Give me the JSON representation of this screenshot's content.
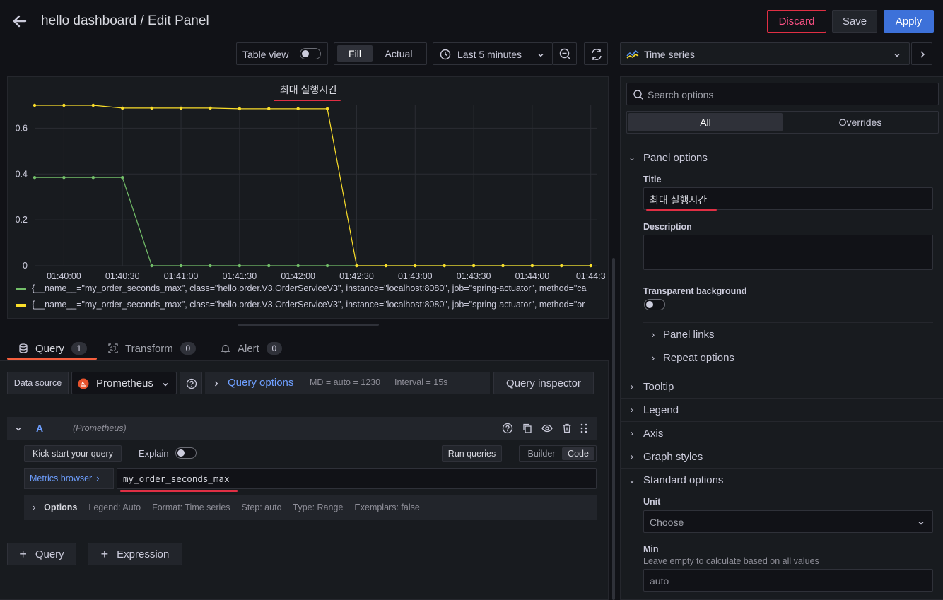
{
  "header": {
    "breadcrumb": "hello dashboard / Edit Panel",
    "discard_label": "Discard",
    "save_label": "Save",
    "apply_label": "Apply"
  },
  "toolbar": {
    "table_view_label": "Table view",
    "fill_label": "Fill",
    "actual_label": "Actual",
    "time_range_label": "Last 5 minutes",
    "visualization_label": "Time series"
  },
  "panel": {
    "title": "최대 실행시간"
  },
  "chart_data": {
    "type": "line",
    "title": "최대 실행시간",
    "x": [
      "01:39:35",
      "01:40:00",
      "01:40:15",
      "01:40:30",
      "01:40:45",
      "01:41:00",
      "01:41:15",
      "01:41:30",
      "01:41:45",
      "01:42:00",
      "01:42:15",
      "01:42:30",
      "01:42:45",
      "01:43:00",
      "01:43:15",
      "01:43:30",
      "01:43:45",
      "01:44:00",
      "01:44:15",
      "01:44:30"
    ],
    "x_tick_labels": [
      "01:40:00",
      "01:40:30",
      "01:41:00",
      "01:41:30",
      "01:42:00",
      "01:42:30",
      "01:43:00",
      "01:43:30",
      "01:44:00",
      "01:44:3"
    ],
    "y_tick_labels": [
      "0",
      "0.2",
      "0.4",
      "0.6"
    ],
    "ylim": [
      0,
      0.7
    ],
    "grid": true,
    "legend_position": "bottom",
    "series": [
      {
        "name": "{__name__=\"my_order_seconds_max\", class=\"hello.order.V3.OrderServiceV3\", instance=\"localhost:8080\", job=\"spring-actuator\", method=\"ca",
        "color": "#73bf69",
        "values": [
          0.385,
          0.385,
          0.385,
          0.385,
          0,
          0,
          0,
          0,
          0,
          0,
          0,
          0,
          0,
          0,
          0,
          0,
          0,
          0,
          0,
          0
        ]
      },
      {
        "name": "{__name__=\"my_order_seconds_max\", class=\"hello.order.V3.OrderServiceV3\", instance=\"localhost:8080\", job=\"spring-actuator\", method=\"or",
        "color": "#fade2a",
        "values": [
          0.7,
          0.7,
          0.7,
          0.688,
          0.688,
          0.688,
          0.688,
          0.685,
          0.685,
          0.685,
          0.685,
          0,
          0,
          0,
          0,
          0,
          0,
          0,
          0,
          0
        ]
      }
    ]
  },
  "tabs": [
    {
      "label": "Query",
      "count": "1"
    },
    {
      "label": "Transform",
      "count": "0"
    },
    {
      "label": "Alert",
      "count": "0"
    }
  ],
  "query_bar": {
    "data_source_label": "Data source",
    "data_source_value": "Prometheus",
    "query_options_label": "Query options",
    "md_text": "MD = auto = 1230",
    "interval_text": "Interval = 15s",
    "query_inspector_label": "Query inspector"
  },
  "query_row": {
    "ref_id": "A",
    "datasource_hint": "(Prometheus)",
    "kick_start_label": "Kick start your query",
    "explain_label": "Explain",
    "run_queries_label": "Run queries",
    "builder_label": "Builder",
    "code_label": "Code",
    "metrics_browser_label": "Metrics browser",
    "expression": "my_order_seconds_max",
    "options_label": "Options",
    "legend_info": "Legend: Auto",
    "format_info": "Format: Time series",
    "step_info": "Step: auto",
    "type_info": "Type: Range",
    "exemplars_info": "Exemplars: false"
  },
  "add_buttons": {
    "query_label": "Query",
    "expression_label": "Expression"
  },
  "options_pane": {
    "search_placeholder": "Search options",
    "all_label": "All",
    "overrides_label": "Overrides",
    "panel_options_label": "Panel options",
    "title_label": "Title",
    "title_value": "최대 실행시간",
    "description_label": "Description",
    "transparent_label": "Transparent background",
    "panel_links_label": "Panel links",
    "repeat_options_label": "Repeat options",
    "tooltip_label": "Tooltip",
    "legend_label": "Legend",
    "axis_label": "Axis",
    "graph_styles_label": "Graph styles",
    "standard_options_label": "Standard options",
    "unit_label": "Unit",
    "unit_value": "Choose",
    "min_label": "Min",
    "min_hint": "Leave empty to calculate based on all values",
    "min_placeholder": "auto"
  }
}
